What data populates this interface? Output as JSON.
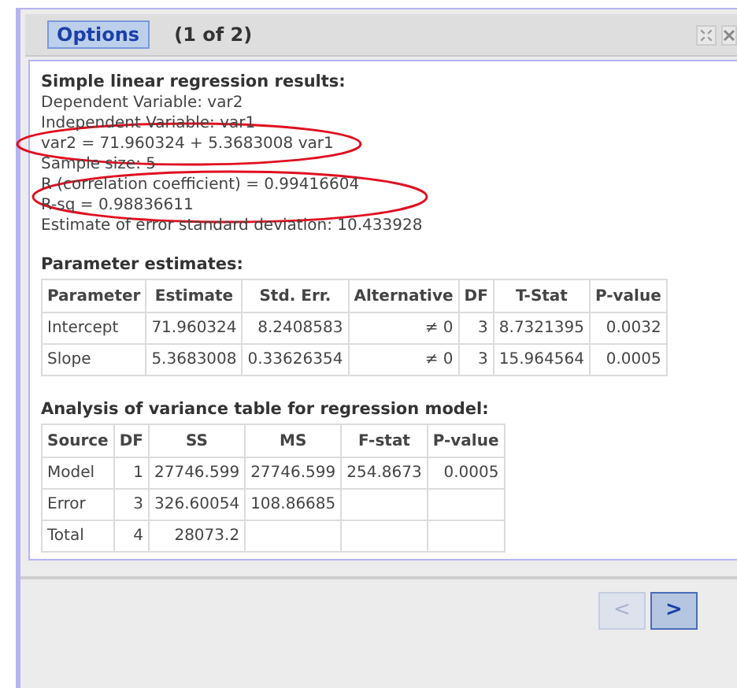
{
  "header": {
    "options_button": "Options",
    "page_indicator": "(1 of 2)"
  },
  "results": {
    "title": "Simple linear regression results:",
    "lines": [
      "Dependent Variable: var2",
      "Independent Variable: var1",
      "var2 = 71.960324 + 5.3683008 var1",
      "Sample size: 5",
      "R (correlation coefficient) = 0.99416604",
      "R-sq = 0.98836611",
      "Estimate of error standard deviation: 10.433928"
    ]
  },
  "parameter_table": {
    "title": "Parameter estimates:",
    "columns": [
      "Parameter",
      "Estimate",
      "Std. Err.",
      "Alternative",
      "DF",
      "T-Stat",
      "P-value"
    ],
    "rows": [
      [
        "Intercept",
        "71.960324",
        "8.2408583",
        "≠ 0",
        "3",
        "8.7321395",
        "0.0032"
      ],
      [
        "Slope",
        "5.3683008",
        "0.33626354",
        "≠ 0",
        "3",
        "15.964564",
        "0.0005"
      ]
    ]
  },
  "anova_table": {
    "title": "Analysis of variance table for regression model:",
    "columns": [
      "Source",
      "DF",
      "SS",
      "MS",
      "F-stat",
      "P-value"
    ],
    "rows": [
      [
        "Model",
        "1",
        "27746.599",
        "27746.599",
        "254.8673",
        "0.0005"
      ],
      [
        "Error",
        "3",
        "326.60054",
        "108.86685",
        "",
        ""
      ],
      [
        "Total",
        "4",
        "28073.2",
        "",
        "",
        ""
      ]
    ]
  },
  "pager": [
    {
      "label": "<",
      "disabled": true
    },
    {
      "label": ">",
      "disabled": false
    }
  ]
}
